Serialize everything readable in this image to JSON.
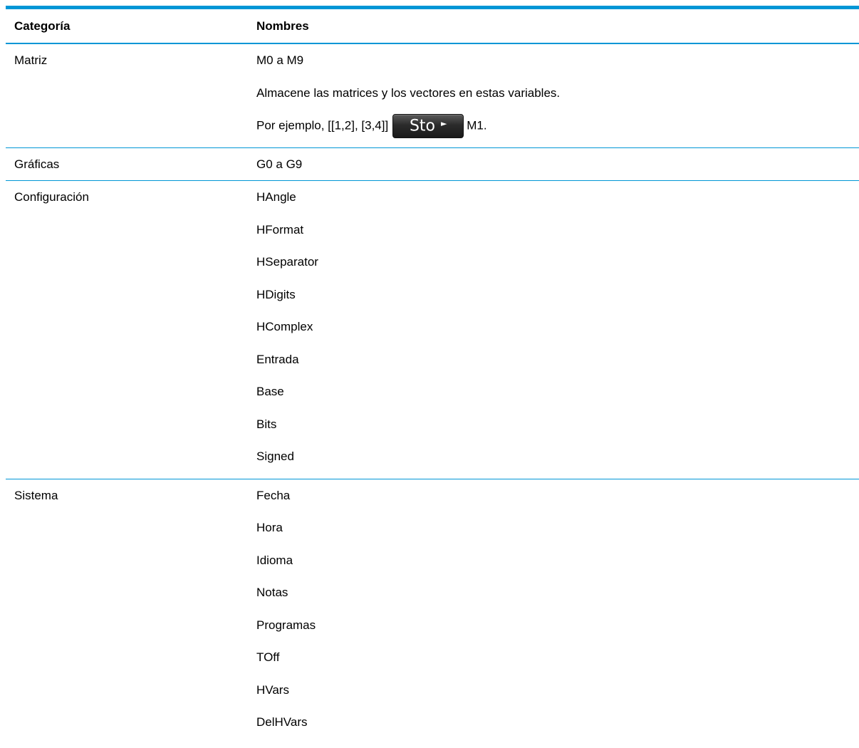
{
  "header": {
    "col1": "Categoría",
    "col2": "Nombres"
  },
  "rows": [
    {
      "category": "Matriz",
      "names": [
        "M0 a M9",
        "Almacene las matrices y los vectores en estas variables."
      ],
      "example": {
        "prefix": "Por ejemplo, [[1,2], [3,4]]",
        "key_label": "Sto",
        "key_arrow": "►",
        "suffix": "M1."
      }
    },
    {
      "category": "Gráficas",
      "names": [
        "G0 a G9"
      ]
    },
    {
      "category": "Configuración",
      "names": [
        "HAngle",
        "HFormat",
        "HSeparator",
        "HDigits",
        "HComplex",
        "Entrada",
        "Base",
        "Bits",
        "Signed"
      ]
    },
    {
      "category": "Sistema",
      "names": [
        "Fecha",
        "Hora",
        "Idioma",
        "Notas",
        "Programas",
        "TOff",
        "HVars",
        "DelHVars"
      ]
    }
  ],
  "colors": {
    "accent": "#0096d6"
  }
}
